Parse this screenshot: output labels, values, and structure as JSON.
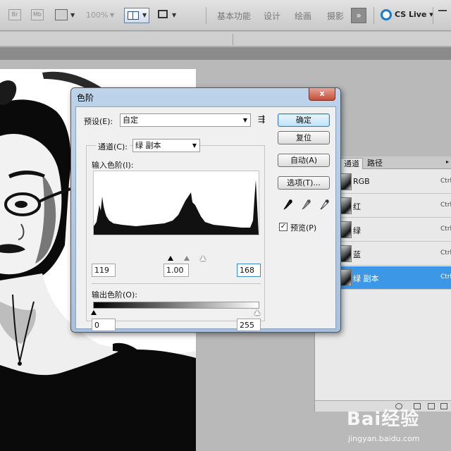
{
  "topbar": {
    "br_icon": "Br",
    "mb_icon": "Mb",
    "zoom": "100%",
    "workspace_links": [
      "基本功能",
      "设计",
      "绘画",
      "摄影"
    ],
    "more": "»",
    "cs_live": "CS Live"
  },
  "levels_dialog": {
    "title": "色阶",
    "preset_label": "预设(E):",
    "preset_value": "自定",
    "channel_label": "通道(C):",
    "channel_value": "绿 副本",
    "input_levels_label": "输入色阶(I):",
    "input_black": "119",
    "input_gamma": "1.00",
    "input_white": "168",
    "output_levels_label": "输出色阶(O):",
    "output_black": "0",
    "output_white": "255",
    "buttons": {
      "ok": "确定",
      "reset": "复位",
      "auto": "自动(A)",
      "options": "选项(T)..."
    },
    "preview_label": "预览(P)",
    "preview_checked": true,
    "close_symbol": "x"
  },
  "channels_panel": {
    "tabs": [
      "通道",
      "路径"
    ],
    "channels": [
      {
        "name": "RGB",
        "shortcut": "Ctrl"
      },
      {
        "name": "红",
        "shortcut": "Ctrl"
      },
      {
        "name": "绿",
        "shortcut": "Ctrl"
      },
      {
        "name": "蓝",
        "shortcut": "Ctrl"
      },
      {
        "name": "绿 副本",
        "shortcut": "Ctrl"
      }
    ],
    "selected_channel": "绿 副本"
  },
  "watermark": {
    "brand": "Bai经验",
    "url": "jingyan.baidu.com"
  }
}
